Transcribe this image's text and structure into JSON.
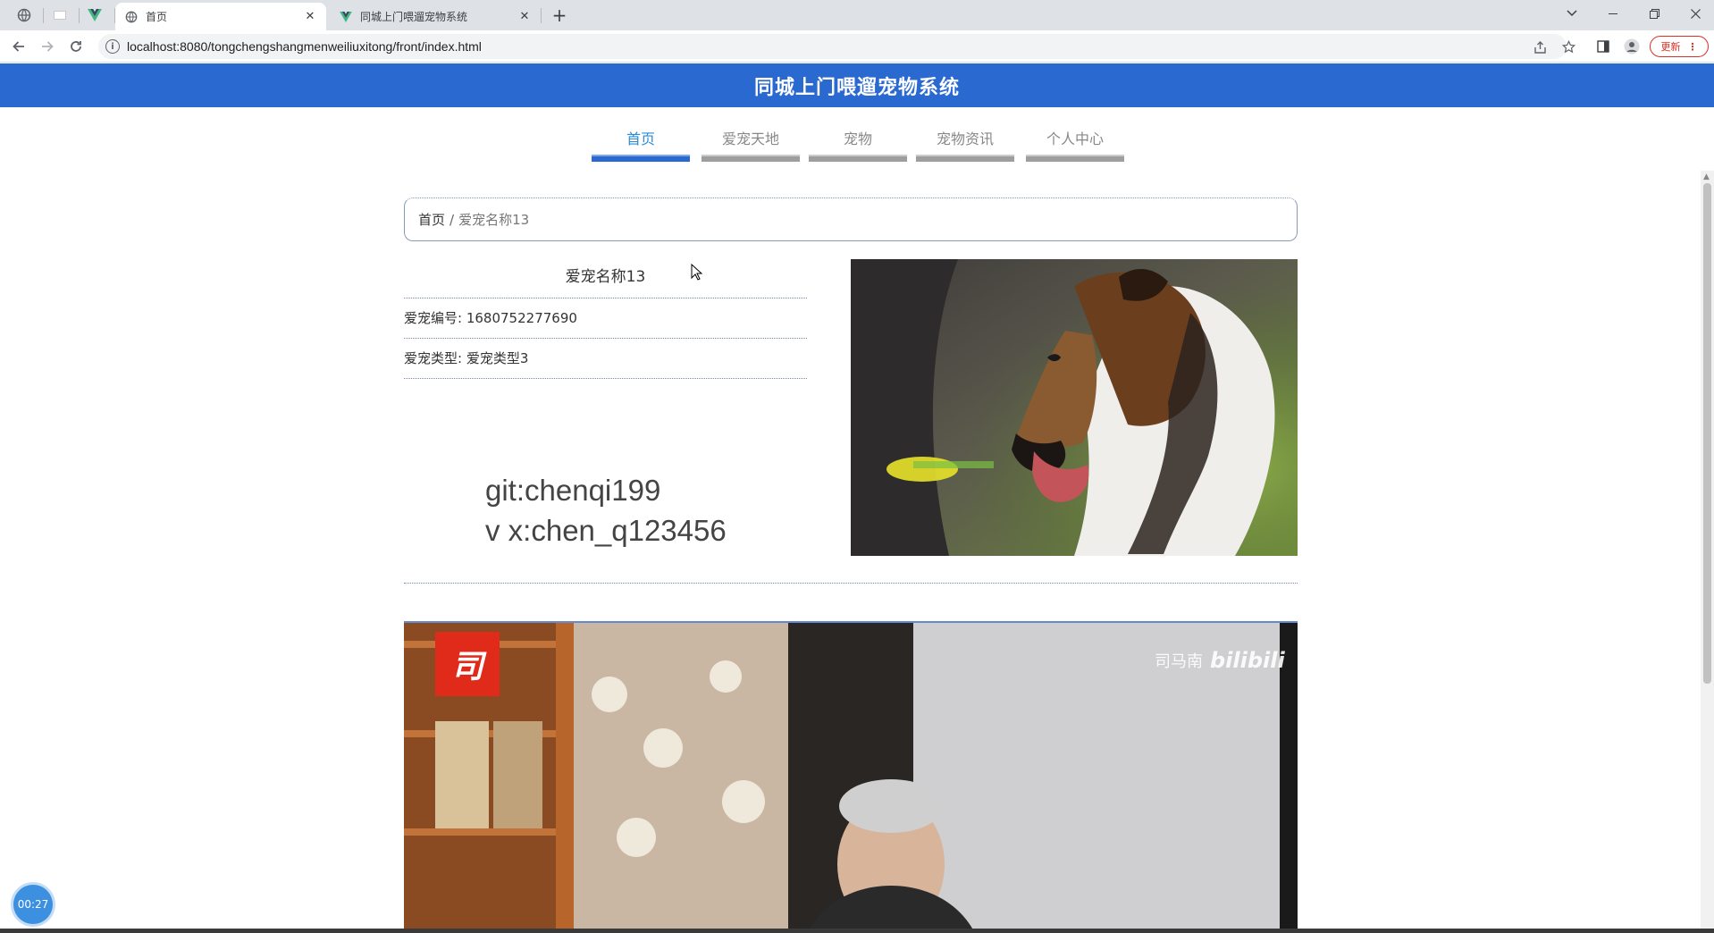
{
  "browser": {
    "tabs": [
      {
        "label": "首页",
        "active": true,
        "icon": "globe-icon"
      },
      {
        "label": "同城上门喂遛宠物系统",
        "active": false,
        "icon": "vue-logo-icon"
      }
    ],
    "url": "localhost:8080/tongchengshangmenweiliuxitong/front/index.html",
    "update_label": "更新"
  },
  "site": {
    "title": "同城上门喂遛宠物系统",
    "nav": [
      "首页",
      "爱宠天地",
      "宠物",
      "宠物资讯",
      "个人中心"
    ],
    "active_nav": 0
  },
  "breadcrumb": {
    "home": "首页",
    "separator": "/",
    "current": "爱宠名称13"
  },
  "pet": {
    "name": "爱宠名称13",
    "id_label": "爱宠编号:",
    "id_value": "1680752277690",
    "type_label": "爱宠类型:",
    "type_value": "爱宠类型3"
  },
  "overlay": {
    "line1": "git:chenqi199",
    "line2": "v x:chen_q123456"
  },
  "video": {
    "channel": "司马南",
    "platform": "bilibili",
    "logo_char": "司"
  },
  "timer": "00:27",
  "colors": {
    "header": "#2a6ad0",
    "active_nav": "#2a8bd6"
  }
}
